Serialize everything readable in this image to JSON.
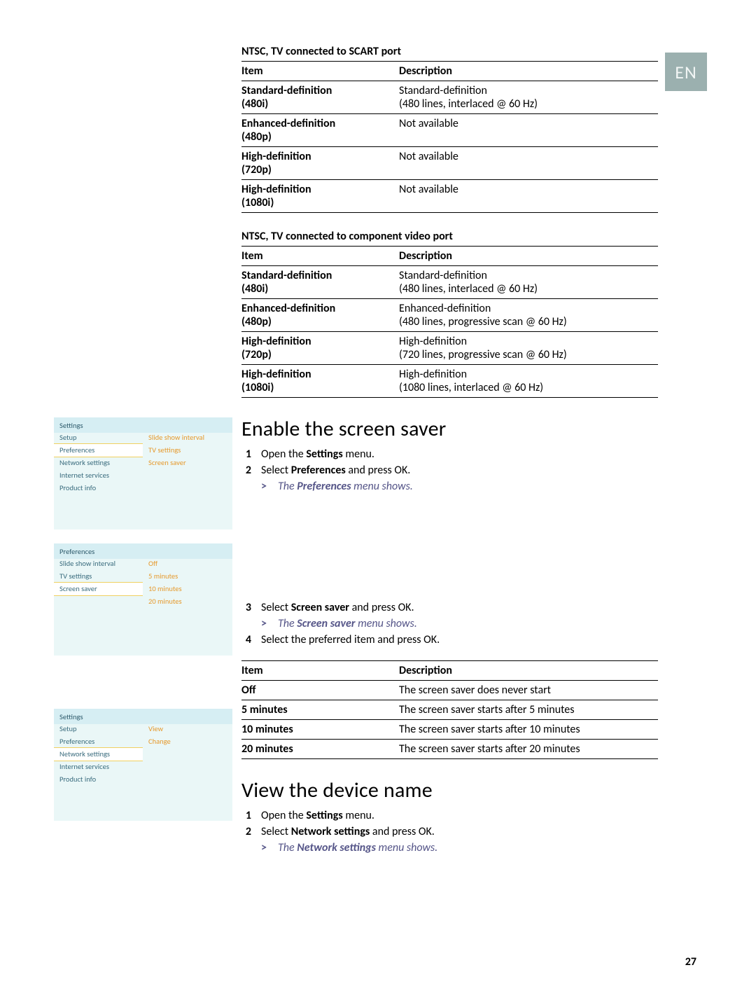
{
  "lang_tab": "EN",
  "page_number": "27",
  "tables": {
    "scart": {
      "caption": "NTSC, TV connected to SCART port",
      "headers": [
        "Item",
        "Description"
      ],
      "rows": [
        {
          "item": "Standard-definition (480i)",
          "desc_l1": "Standard-definition",
          "desc_l2": "(480 lines, interlaced @ 60 Hz)"
        },
        {
          "item": "Enhanced-definition (480p)",
          "desc_l1": "Not available",
          "desc_l2": ""
        },
        {
          "item": "High-definition (720p)",
          "desc_l1": "Not available",
          "desc_l2": ""
        },
        {
          "item": "High-definition (1080i)",
          "desc_l1": "Not available",
          "desc_l2": ""
        }
      ]
    },
    "component": {
      "caption": "NTSC, TV connected to component video port",
      "headers": [
        "Item",
        "Description"
      ],
      "rows": [
        {
          "item": "Standard-definition (480i)",
          "desc_l1": "Standard-definition",
          "desc_l2": "(480 lines, interlaced @ 60 Hz)"
        },
        {
          "item": "Enhanced-definition (480p)",
          "desc_l1": "Enhanced-definition",
          "desc_l2": "(480 lines, progressive scan @ 60 Hz)"
        },
        {
          "item": "High-definition (720p)",
          "desc_l1": "High-definition",
          "desc_l2": "(720 lines, progressive scan @ 60 Hz)"
        },
        {
          "item": "High-definition (1080i)",
          "desc_l1": "High-definition",
          "desc_l2": "(1080 lines, interlaced @ 60 Hz)"
        }
      ]
    },
    "saver": {
      "headers": [
        "Item",
        "Description"
      ],
      "rows": [
        {
          "item": "Off",
          "desc": "The screen saver does never start"
        },
        {
          "item": "5 minutes",
          "desc": "The screen saver starts after 5 minutes"
        },
        {
          "item": "10 minutes",
          "desc": "The screen saver starts after 10 minutes"
        },
        {
          "item": "20 minutes",
          "desc": "The screen saver starts after 20 minutes"
        }
      ]
    }
  },
  "sections": {
    "enable": {
      "title": "Enable the screen saver",
      "steps": {
        "s1": {
          "num": "1",
          "pre": "Open the ",
          "bold": "Settings",
          "post": " menu."
        },
        "s2": {
          "num": "2",
          "pre": "Select ",
          "bold": "Preferences",
          "post": " and press OK."
        },
        "r2": {
          "arrow": ">",
          "pre": "The ",
          "bold": "Preferences",
          "post": " menu shows."
        },
        "s3": {
          "num": "3",
          "pre": "Select ",
          "bold": "Screen saver",
          "post": " and press OK."
        },
        "r3": {
          "arrow": ">",
          "pre": "The ",
          "bold": "Screen saver",
          "post": " menu shows."
        },
        "s4": {
          "num": "4",
          "pre": "Select the preferred item and press OK.",
          "bold": "",
          "post": ""
        }
      }
    },
    "view": {
      "title": "View the device name",
      "steps": {
        "s1": {
          "num": "1",
          "pre": "Open the ",
          "bold": "Settings",
          "post": " menu."
        },
        "s2": {
          "num": "2",
          "pre": "Select ",
          "bold": "Network settings",
          "post": " and press OK."
        },
        "r2": {
          "arrow": ">",
          "pre": "The ",
          "bold": "Network settings",
          "post": " menu shows."
        }
      }
    }
  },
  "ui_panels": {
    "settings_prefs": {
      "title": "Settings",
      "left": [
        "Setup",
        "Preferences",
        "Network settings",
        "Internet services",
        "Product info"
      ],
      "left_selected_index": 1,
      "right": [
        "Slide show interval",
        "TV settings",
        "Screen saver"
      ]
    },
    "prefs_saver": {
      "title": "Preferences",
      "left": [
        "Slide show interval",
        "TV settings",
        "Screen saver"
      ],
      "left_selected_index": 2,
      "right": [
        "Off",
        "5 minutes",
        "10 minutes",
        "20 minutes"
      ]
    },
    "settings_net": {
      "title": "Settings",
      "left": [
        "Setup",
        "Preferences",
        "Network settings",
        "Internet services",
        "Product info"
      ],
      "left_selected_index": 2,
      "right": [
        "View",
        "Change"
      ]
    }
  }
}
